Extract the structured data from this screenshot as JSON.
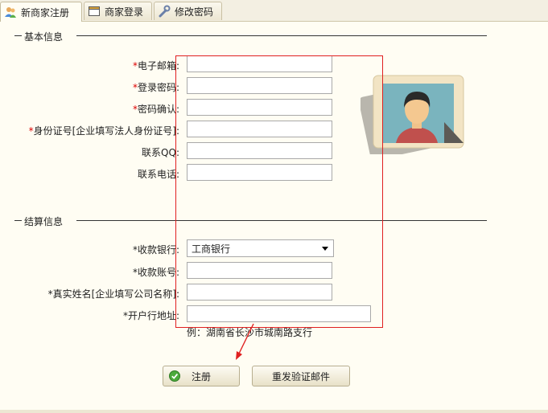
{
  "tabs": [
    {
      "label": "新商家注册",
      "icon": "users-icon",
      "active": true
    },
    {
      "label": "商家登录",
      "icon": "window-icon",
      "active": false
    },
    {
      "label": "修改密码",
      "icon": "wrench-icon",
      "active": false
    }
  ],
  "basic_section": {
    "title": "基本信息"
  },
  "basic_fields": [
    {
      "label": "电子邮箱",
      "required": true,
      "value": ""
    },
    {
      "label": "登录密码",
      "required": true,
      "value": ""
    },
    {
      "label": "密码确认",
      "required": true,
      "value": ""
    },
    {
      "label": "身份证号[企业填写法人身份证号]",
      "required": true,
      "value": ""
    },
    {
      "label": "联系QQ",
      "required": false,
      "value": ""
    },
    {
      "label": "联系电话",
      "required": false,
      "value": ""
    }
  ],
  "settle_section": {
    "title": "结算信息"
  },
  "settle_fields": {
    "bank": {
      "label": "*收款银行",
      "selected": "工商银行"
    },
    "account": {
      "label": "*收款账号",
      "value": ""
    },
    "real_name": {
      "label": "*真实姓名[企业填写公司名称]",
      "value": ""
    },
    "bank_address": {
      "label": "*开户行地址",
      "value": ""
    }
  },
  "hint": "例：湖南省长沙市城南路支行",
  "buttons": {
    "register": "注册",
    "resend": "重发验证邮件"
  },
  "colors": {
    "accent_red": "#e02020",
    "required_star": "#dd0000",
    "background": "#fffdf3"
  }
}
